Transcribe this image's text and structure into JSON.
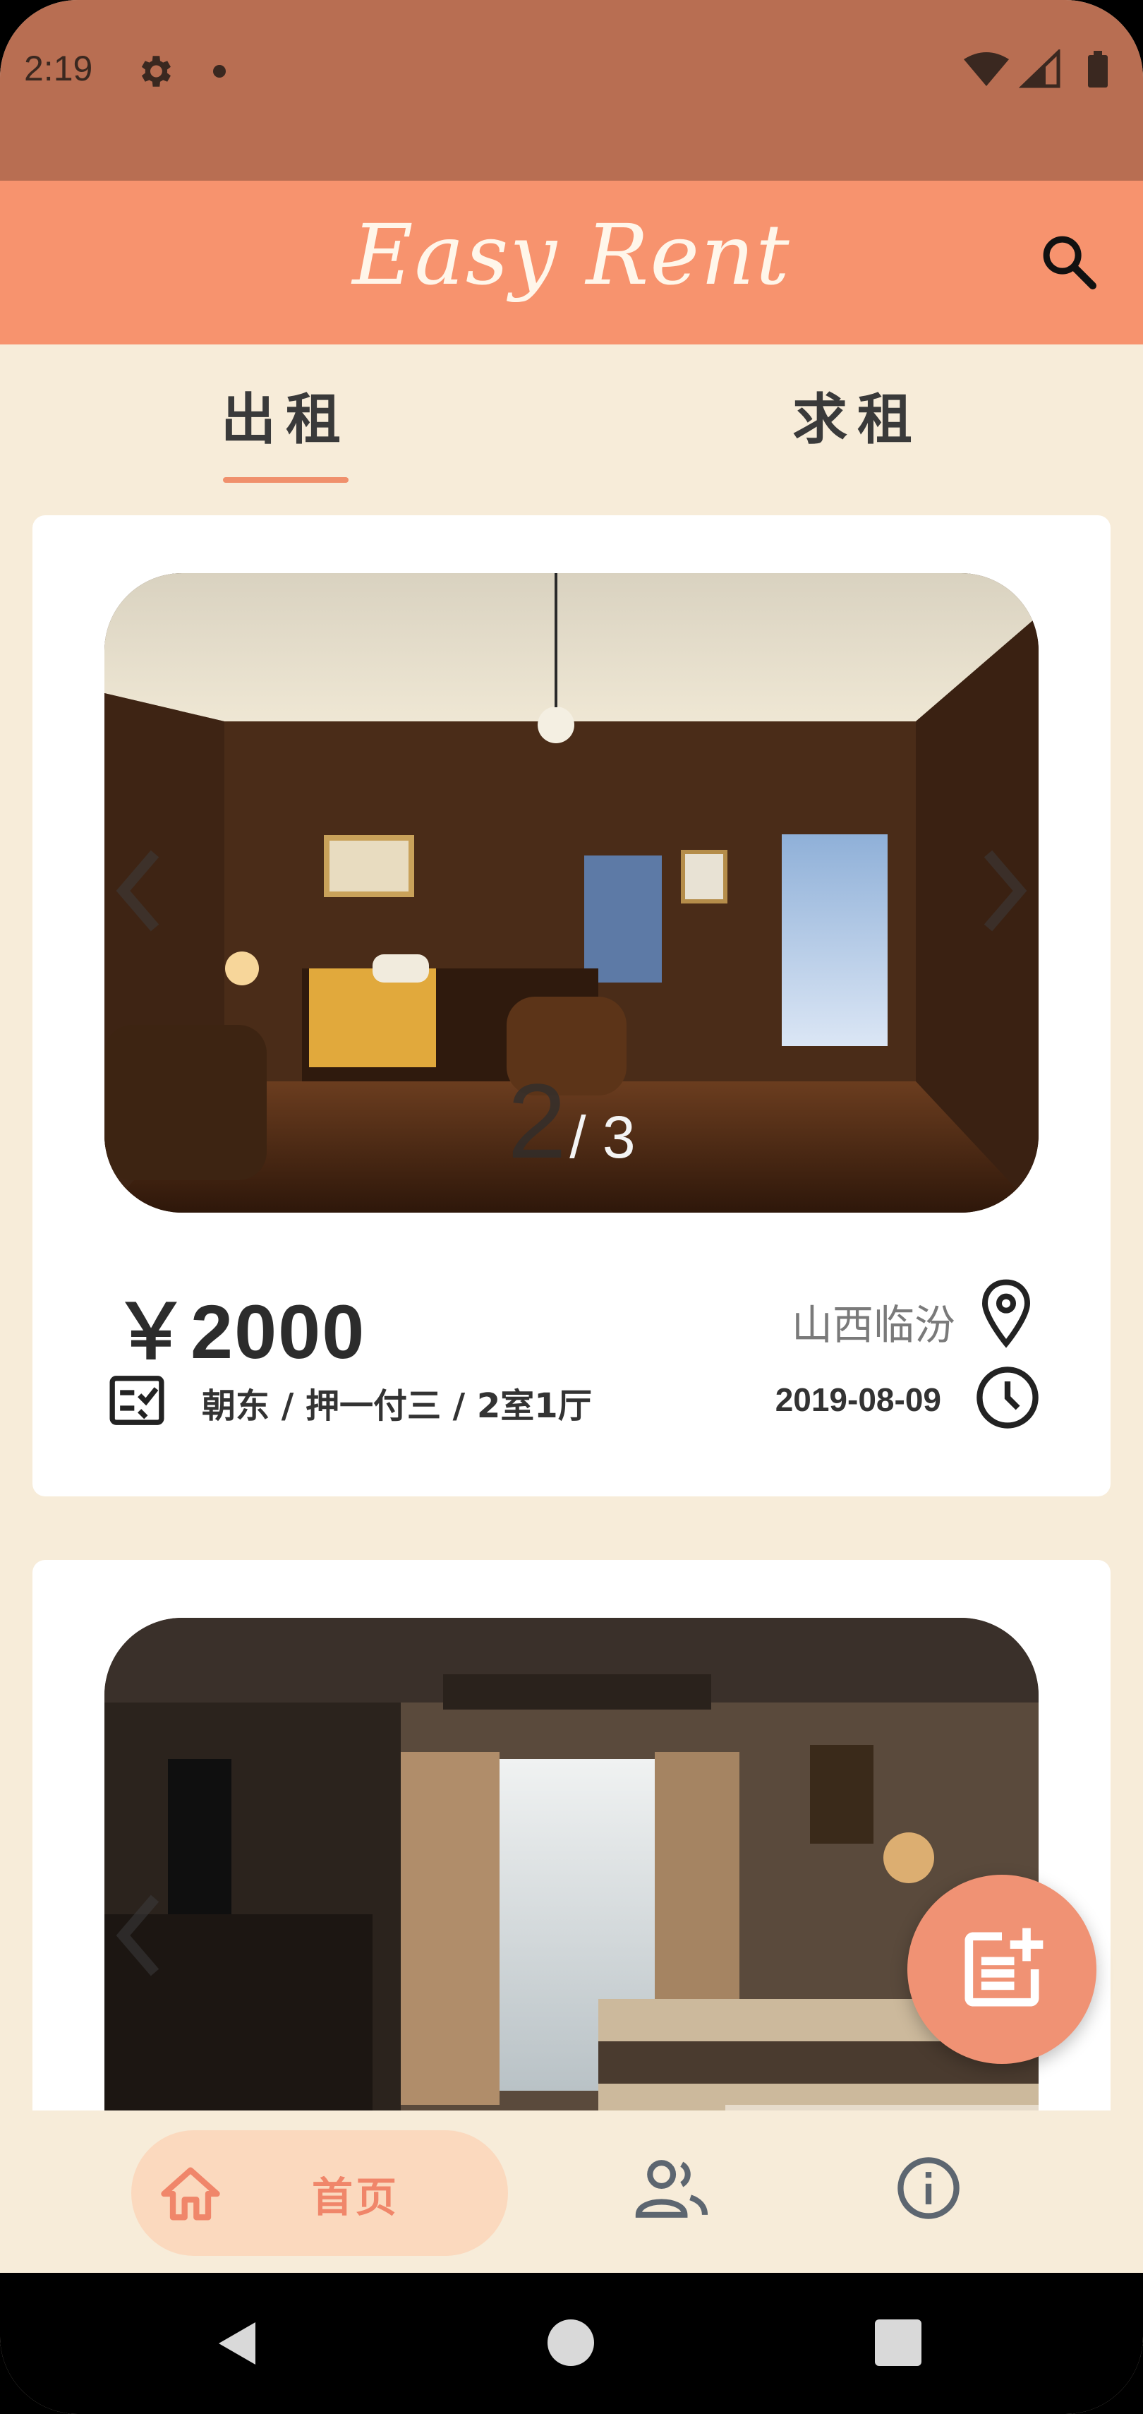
{
  "status_bar": {
    "time": "2:19"
  },
  "app_bar": {
    "title": "Easy Rent"
  },
  "tabs": [
    {
      "label": "出租",
      "selected": true
    },
    {
      "label": "求租",
      "selected": false
    }
  ],
  "listings": [
    {
      "image_counter": {
        "current": "2",
        "total": "/ 3"
      },
      "price": "￥2000",
      "location": "山西临汾",
      "specs": "朝东 / 押一付三 / 2室1厅",
      "date": "2019-08-09"
    }
  ],
  "bottom_nav": {
    "items": [
      {
        "label": "首页",
        "icon": "home-icon",
        "selected": true
      },
      {
        "label": "",
        "icon": "people-icon",
        "selected": false
      },
      {
        "label": "",
        "icon": "info-icon",
        "selected": false
      }
    ]
  },
  "colors": {
    "status_bar": "#B86E52",
    "app_bar": "#F7936E",
    "background": "#F7ECD9",
    "accent": "#F0906C",
    "nav_pill": "#FBD9BE"
  }
}
